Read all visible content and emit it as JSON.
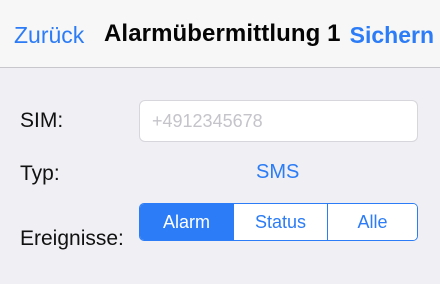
{
  "navbar": {
    "back_label": "Zurück",
    "title": "Alarmübermittlung 1",
    "save_label": "Sichern"
  },
  "form": {
    "sim": {
      "label": "SIM:",
      "value": "",
      "placeholder": "+4912345678"
    },
    "type": {
      "label": "Typ:",
      "value": "SMS"
    },
    "events": {
      "label": "Ereignisse:",
      "options": [
        {
          "label": "Alarm",
          "selected": true
        },
        {
          "label": "Status",
          "selected": false
        },
        {
          "label": "Alle",
          "selected": false
        }
      ]
    }
  },
  "colors": {
    "accent": "#2b7cf6",
    "navbar_background": "#f7f7f8",
    "screen_background": "#efeff4",
    "field_background": "#ffffff",
    "placeholder": "#c4c4ca"
  }
}
